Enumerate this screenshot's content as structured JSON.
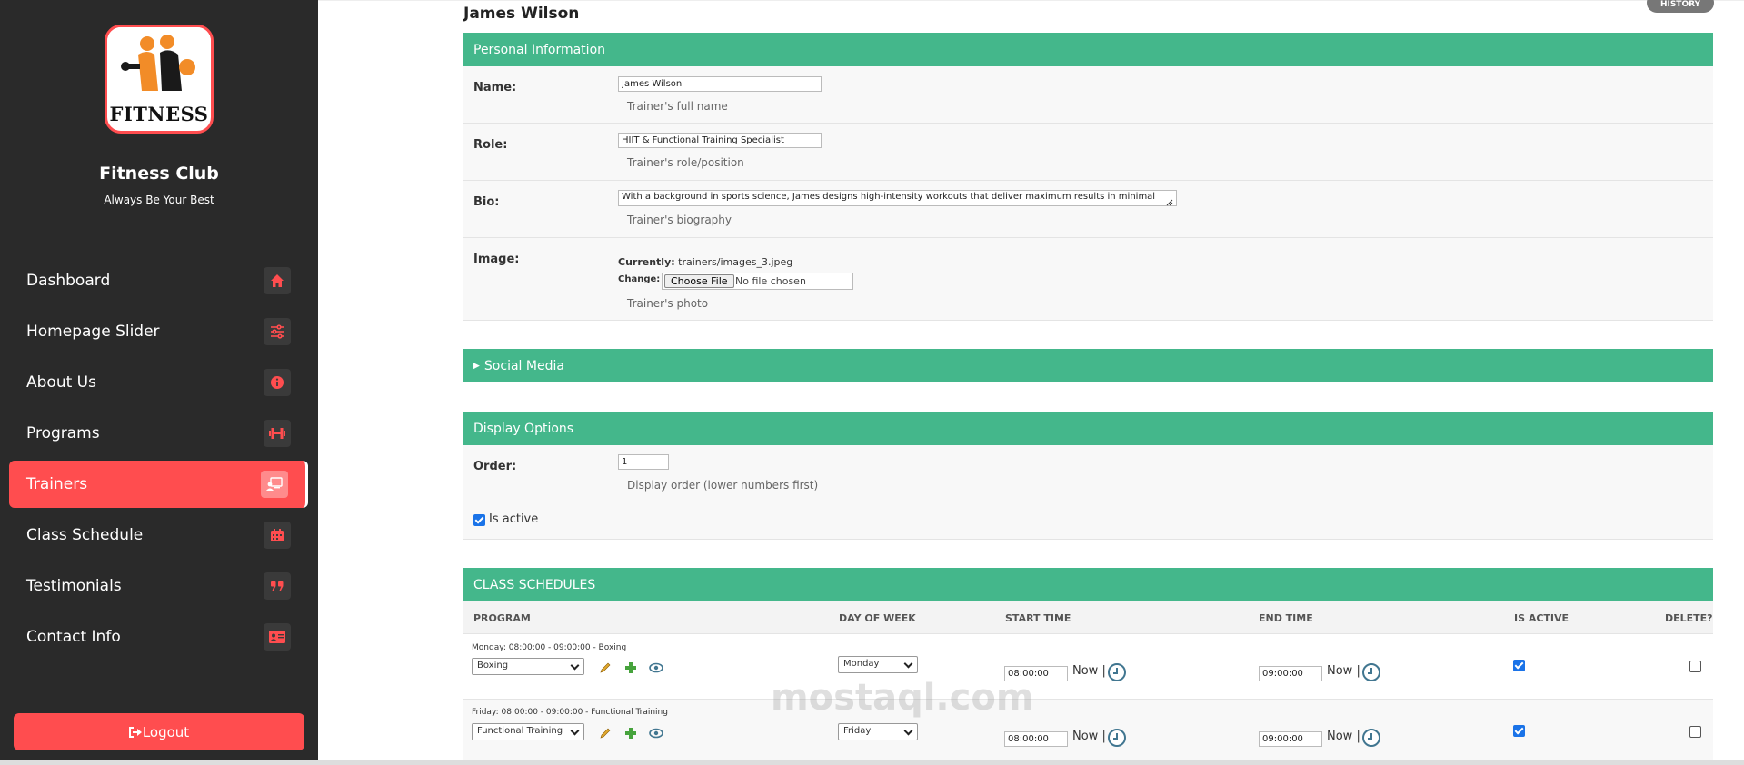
{
  "brand": {
    "title": "Fitness Club",
    "subtitle": "Always Be Your Best",
    "logo_text": "FITNESS"
  },
  "nav": [
    {
      "label": "Dashboard",
      "icon": "home-icon"
    },
    {
      "label": "Homepage Slider",
      "icon": "sliders-icon"
    },
    {
      "label": "About Us",
      "icon": "info-icon"
    },
    {
      "label": "Programs",
      "icon": "dumbbell-icon"
    },
    {
      "label": "Trainers",
      "icon": "trainer-icon",
      "active": true
    },
    {
      "label": "Class Schedule",
      "icon": "calendar-icon"
    },
    {
      "label": "Testimonials",
      "icon": "quote-icon"
    },
    {
      "label": "Contact Info",
      "icon": "id-card-icon"
    }
  ],
  "logout_label": "Logout",
  "page": {
    "title": "James Wilson",
    "history": "HISTORY"
  },
  "personal": {
    "heading": "Personal Information",
    "name": {
      "label": "Name:",
      "value": "James Wilson",
      "help": "Trainer's full name"
    },
    "role": {
      "label": "Role:",
      "value": "HIIT & Functional Training Specialist",
      "help": "Trainer's role/position"
    },
    "bio": {
      "label": "Bio:",
      "value": "With a background in sports science, James designs high-intensity workouts that deliver maximum results in minimal",
      "help": "Trainer's biography"
    },
    "image": {
      "label": "Image:",
      "currently_label": "Currently:",
      "currently_value": "trainers/images_3.jpeg",
      "change_label": "Change:",
      "choose_button": "Choose File",
      "no_file": "No file chosen",
      "help": "Trainer's photo"
    }
  },
  "social": {
    "heading": "Social Media"
  },
  "display": {
    "heading": "Display Options",
    "order": {
      "label": "Order:",
      "value": "1",
      "help": "Display order (lower numbers first)"
    },
    "is_active_label": "Is active",
    "is_active": true
  },
  "schedules": {
    "heading": "CLASS SCHEDULES",
    "columns": [
      "PROGRAM",
      "DAY OF WEEK",
      "START TIME",
      "END TIME",
      "IS ACTIVE",
      "DELETE?"
    ],
    "now_label": "Now",
    "rows": [
      {
        "summary": "Monday: 08:00:00 - 09:00:00 - Boxing",
        "program": "Boxing",
        "day": "Monday",
        "start": "08:00:00",
        "end": "09:00:00",
        "active": true,
        "delete": false
      },
      {
        "summary": "Friday: 08:00:00 - 09:00:00 - Functional Training",
        "program": "Functional Training",
        "day": "Friday",
        "start": "08:00:00",
        "end": "09:00:00",
        "active": true,
        "delete": false
      }
    ]
  },
  "watermark": "mostaql.com",
  "colors": {
    "sidebar": "#2a2a2a",
    "accent": "#ff4d4f",
    "section_green": "#44b78b",
    "link_blue": "#417690"
  }
}
